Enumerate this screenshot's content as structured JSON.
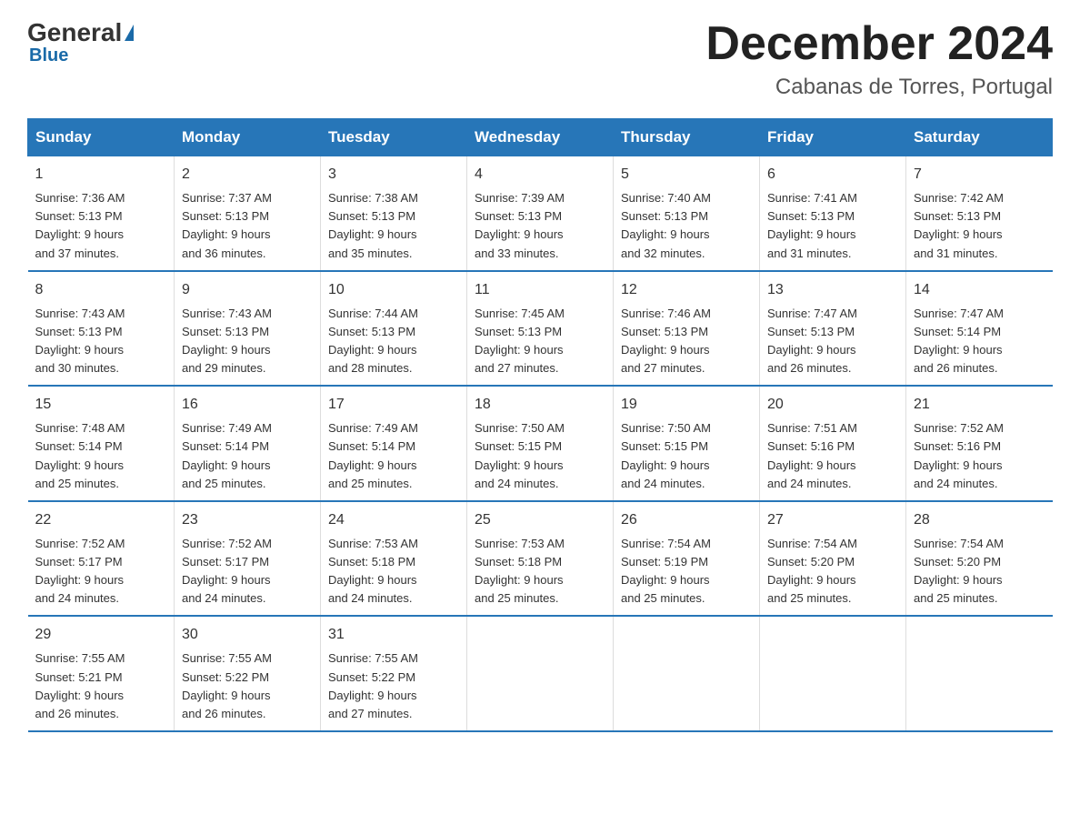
{
  "logo": {
    "general": "General",
    "blue": "Blue"
  },
  "title": "December 2024",
  "subtitle": "Cabanas de Torres, Portugal",
  "days_header": [
    "Sunday",
    "Monday",
    "Tuesday",
    "Wednesday",
    "Thursday",
    "Friday",
    "Saturday"
  ],
  "weeks": [
    [
      {
        "day": "1",
        "sunrise": "7:36 AM",
        "sunset": "5:13 PM",
        "daylight": "9 hours and 37 minutes."
      },
      {
        "day": "2",
        "sunrise": "7:37 AM",
        "sunset": "5:13 PM",
        "daylight": "9 hours and 36 minutes."
      },
      {
        "day": "3",
        "sunrise": "7:38 AM",
        "sunset": "5:13 PM",
        "daylight": "9 hours and 35 minutes."
      },
      {
        "day": "4",
        "sunrise": "7:39 AM",
        "sunset": "5:13 PM",
        "daylight": "9 hours and 33 minutes."
      },
      {
        "day": "5",
        "sunrise": "7:40 AM",
        "sunset": "5:13 PM",
        "daylight": "9 hours and 32 minutes."
      },
      {
        "day": "6",
        "sunrise": "7:41 AM",
        "sunset": "5:13 PM",
        "daylight": "9 hours and 31 minutes."
      },
      {
        "day": "7",
        "sunrise": "7:42 AM",
        "sunset": "5:13 PM",
        "daylight": "9 hours and 31 minutes."
      }
    ],
    [
      {
        "day": "8",
        "sunrise": "7:43 AM",
        "sunset": "5:13 PM",
        "daylight": "9 hours and 30 minutes."
      },
      {
        "day": "9",
        "sunrise": "7:43 AM",
        "sunset": "5:13 PM",
        "daylight": "9 hours and 29 minutes."
      },
      {
        "day": "10",
        "sunrise": "7:44 AM",
        "sunset": "5:13 PM",
        "daylight": "9 hours and 28 minutes."
      },
      {
        "day": "11",
        "sunrise": "7:45 AM",
        "sunset": "5:13 PM",
        "daylight": "9 hours and 27 minutes."
      },
      {
        "day": "12",
        "sunrise": "7:46 AM",
        "sunset": "5:13 PM",
        "daylight": "9 hours and 27 minutes."
      },
      {
        "day": "13",
        "sunrise": "7:47 AM",
        "sunset": "5:13 PM",
        "daylight": "9 hours and 26 minutes."
      },
      {
        "day": "14",
        "sunrise": "7:47 AM",
        "sunset": "5:14 PM",
        "daylight": "9 hours and 26 minutes."
      }
    ],
    [
      {
        "day": "15",
        "sunrise": "7:48 AM",
        "sunset": "5:14 PM",
        "daylight": "9 hours and 25 minutes."
      },
      {
        "day": "16",
        "sunrise": "7:49 AM",
        "sunset": "5:14 PM",
        "daylight": "9 hours and 25 minutes."
      },
      {
        "day": "17",
        "sunrise": "7:49 AM",
        "sunset": "5:14 PM",
        "daylight": "9 hours and 25 minutes."
      },
      {
        "day": "18",
        "sunrise": "7:50 AM",
        "sunset": "5:15 PM",
        "daylight": "9 hours and 24 minutes."
      },
      {
        "day": "19",
        "sunrise": "7:50 AM",
        "sunset": "5:15 PM",
        "daylight": "9 hours and 24 minutes."
      },
      {
        "day": "20",
        "sunrise": "7:51 AM",
        "sunset": "5:16 PM",
        "daylight": "9 hours and 24 minutes."
      },
      {
        "day": "21",
        "sunrise": "7:52 AM",
        "sunset": "5:16 PM",
        "daylight": "9 hours and 24 minutes."
      }
    ],
    [
      {
        "day": "22",
        "sunrise": "7:52 AM",
        "sunset": "5:17 PM",
        "daylight": "9 hours and 24 minutes."
      },
      {
        "day": "23",
        "sunrise": "7:52 AM",
        "sunset": "5:17 PM",
        "daylight": "9 hours and 24 minutes."
      },
      {
        "day": "24",
        "sunrise": "7:53 AM",
        "sunset": "5:18 PM",
        "daylight": "9 hours and 24 minutes."
      },
      {
        "day": "25",
        "sunrise": "7:53 AM",
        "sunset": "5:18 PM",
        "daylight": "9 hours and 25 minutes."
      },
      {
        "day": "26",
        "sunrise": "7:54 AM",
        "sunset": "5:19 PM",
        "daylight": "9 hours and 25 minutes."
      },
      {
        "day": "27",
        "sunrise": "7:54 AM",
        "sunset": "5:20 PM",
        "daylight": "9 hours and 25 minutes."
      },
      {
        "day": "28",
        "sunrise": "7:54 AM",
        "sunset": "5:20 PM",
        "daylight": "9 hours and 25 minutes."
      }
    ],
    [
      {
        "day": "29",
        "sunrise": "7:55 AM",
        "sunset": "5:21 PM",
        "daylight": "9 hours and 26 minutes."
      },
      {
        "day": "30",
        "sunrise": "7:55 AM",
        "sunset": "5:22 PM",
        "daylight": "9 hours and 26 minutes."
      },
      {
        "day": "31",
        "sunrise": "7:55 AM",
        "sunset": "5:22 PM",
        "daylight": "9 hours and 27 minutes."
      },
      null,
      null,
      null,
      null
    ]
  ],
  "labels": {
    "sunrise": "Sunrise:",
    "sunset": "Sunset:",
    "daylight": "Daylight:"
  }
}
